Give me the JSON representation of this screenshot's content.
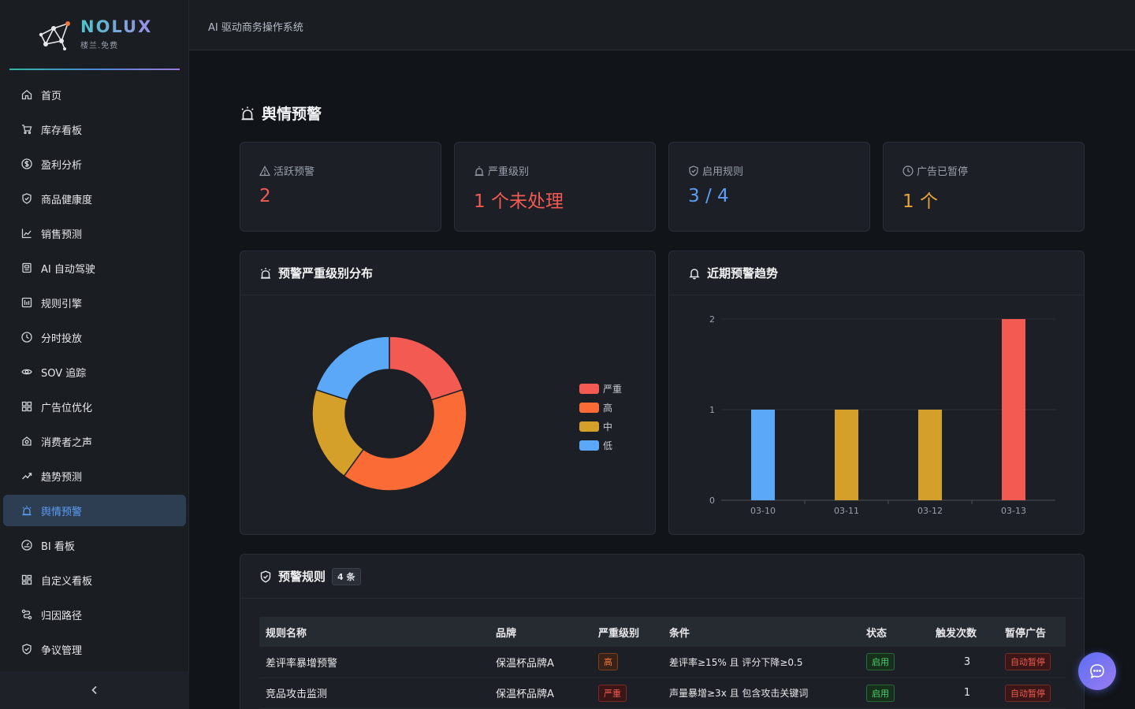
{
  "brand": {
    "name": "NOLUX",
    "subtitle": "楼兰.免费"
  },
  "header": {
    "title": "AI 驱动商务操作系统"
  },
  "sidebar": {
    "items": [
      {
        "label": "首页",
        "icon": "home-icon"
      },
      {
        "label": "库存看板",
        "icon": "cart-icon"
      },
      {
        "label": "盈利分析",
        "icon": "dollar-icon"
      },
      {
        "label": "商品健康度",
        "icon": "shield-check-icon"
      },
      {
        "label": "销售预测",
        "icon": "line-chart-icon"
      },
      {
        "label": "AI 自动驾驶",
        "icon": "robot-icon"
      },
      {
        "label": "规则引擎",
        "icon": "rules-icon"
      },
      {
        "label": "分时投放",
        "icon": "clock-icon"
      },
      {
        "label": "SOV 追踪",
        "icon": "eye-icon"
      },
      {
        "label": "广告位优化",
        "icon": "grid-icon"
      },
      {
        "label": "消费者之声",
        "icon": "voice-icon"
      },
      {
        "label": "趋势预测",
        "icon": "trend-icon"
      },
      {
        "label": "舆情预警",
        "icon": "alarm-icon",
        "active": true
      },
      {
        "label": "BI 看板",
        "icon": "gauge-icon"
      },
      {
        "label": "自定义看板",
        "icon": "layout-icon"
      },
      {
        "label": "归因路径",
        "icon": "route-icon"
      },
      {
        "label": "争议管理",
        "icon": "shield-icon"
      }
    ],
    "collapse_label": "‹"
  },
  "page": {
    "title": "舆情预警"
  },
  "stats": [
    {
      "label": "活跃预警",
      "value": "2",
      "color": "#f25a52",
      "icon": "warning-icon"
    },
    {
      "label": "严重级别",
      "value": "1 个未处理",
      "color": "#f25a52",
      "icon": "alarm-icon"
    },
    {
      "label": "启用规则",
      "value": "3 / 4",
      "color": "#5b9ef5",
      "icon": "shield-check-icon"
    },
    {
      "label": "广告已暂停",
      "value": "1 个",
      "color": "#e8a33a",
      "icon": "clock-icon"
    }
  ],
  "severity_panel": {
    "title": "预警严重级别分布"
  },
  "trend_panel": {
    "title": "近期预警趋势"
  },
  "chart_data": [
    {
      "type": "pie",
      "categories": [
        "严重",
        "高",
        "中",
        "低"
      ],
      "values": [
        1,
        2,
        1,
        1
      ],
      "colors": [
        "#f25a52",
        "#fa6b35",
        "#d4a02a",
        "#5aa8f7"
      ],
      "donut": true,
      "legend": "right"
    },
    {
      "type": "bar",
      "categories": [
        "03-10",
        "03-11",
        "03-12",
        "03-13"
      ],
      "values": [
        1,
        1,
        1,
        2
      ],
      "colors": [
        "#5aa8f7",
        "#d4a02a",
        "#d4a02a",
        "#f25a52"
      ],
      "yticks": [
        "0",
        "1",
        "2"
      ],
      "ylim": [
        0,
        2
      ],
      "grid": true
    }
  ],
  "rules_panel": {
    "title": "预警规则",
    "count_badge": "4 条",
    "columns": [
      "规则名称",
      "品牌",
      "严重级别",
      "条件",
      "状态",
      "触发次数",
      "暂停广告"
    ],
    "rows": [
      {
        "name": "差评率暴增预警",
        "brand": "保温杯品牌A",
        "severity": "高",
        "severity_kind": "high",
        "condition": "差评率≥15% 且 评分下降≥0.5",
        "status": "启用",
        "triggers": "3",
        "pause": "自动暂停"
      },
      {
        "name": "竞品攻击监测",
        "brand": "保温杯品牌A",
        "severity": "严重",
        "severity_kind": "critical",
        "condition": "声量暴增≥3x 且 包含攻击关键词",
        "status": "启用",
        "triggers": "1",
        "pause": "自动暂停"
      }
    ]
  }
}
